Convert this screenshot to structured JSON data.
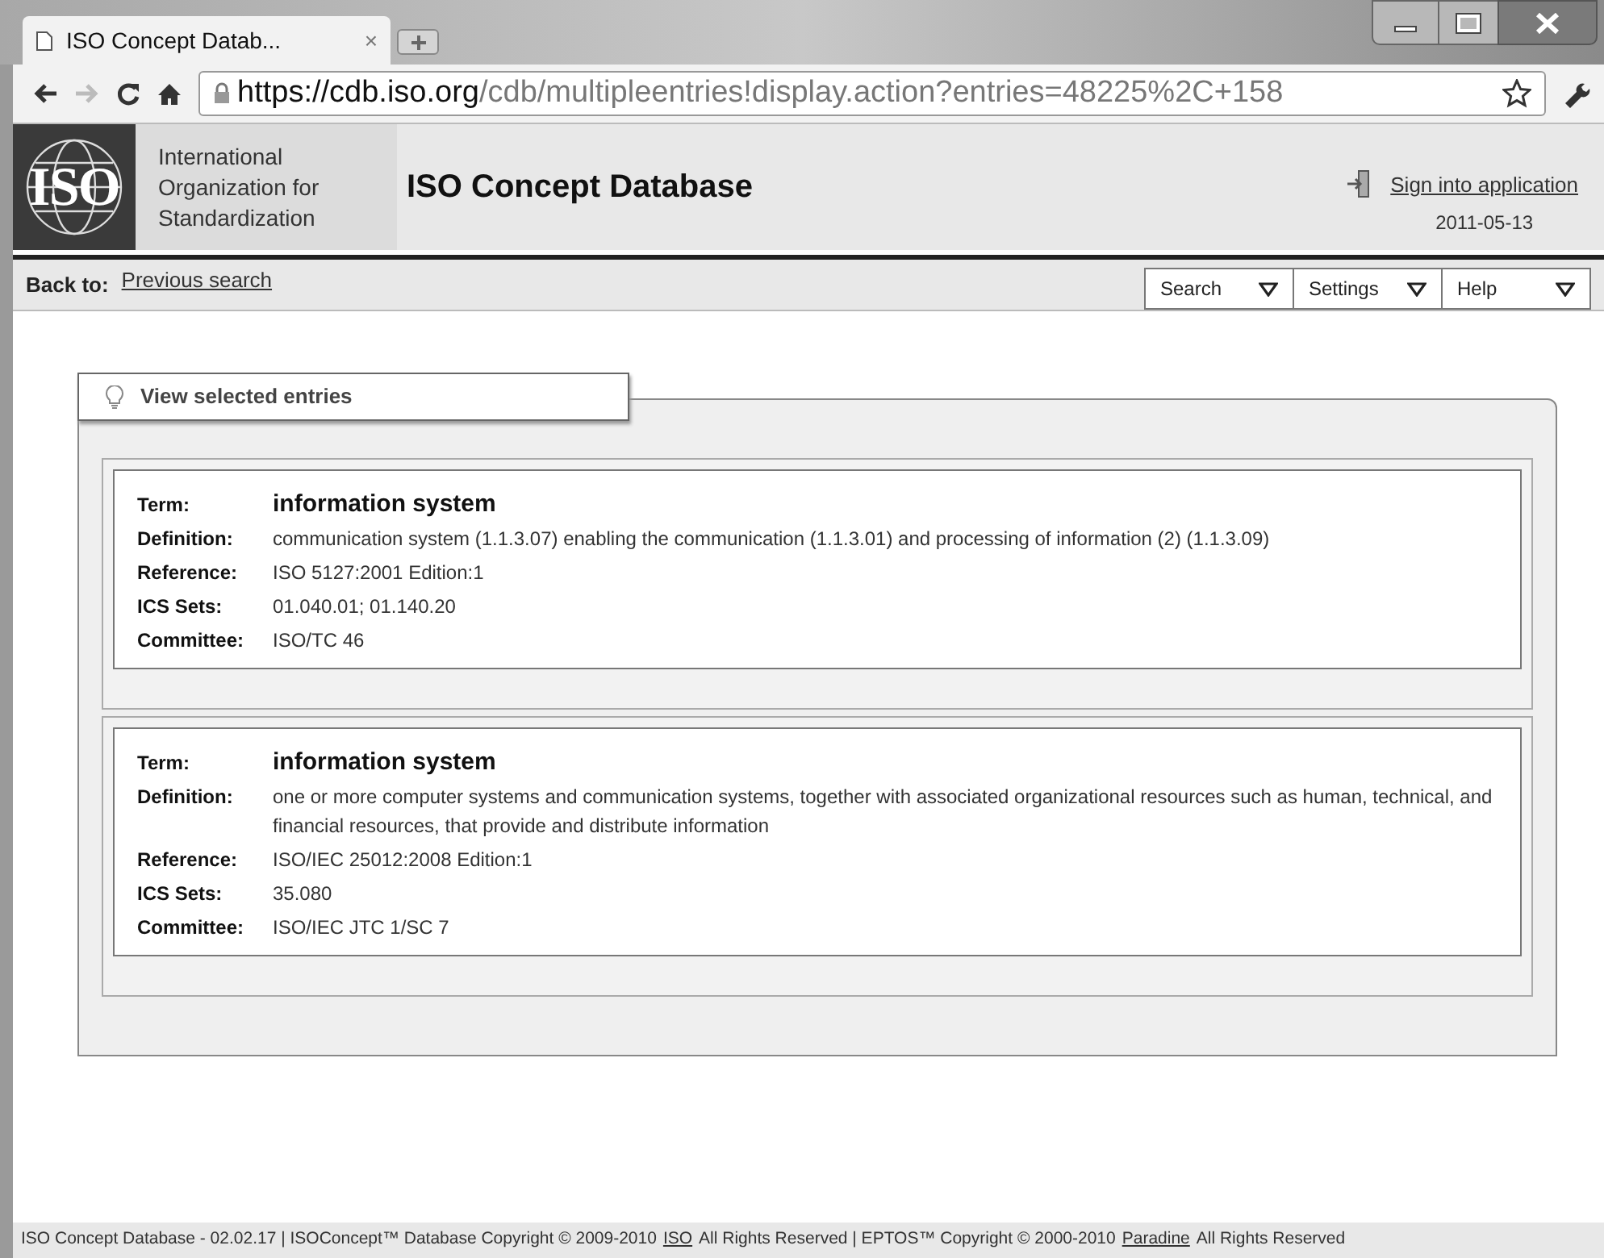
{
  "browser": {
    "tab_title": "ISO Concept Datab...",
    "tab_close": "×",
    "url_host": "https://cdb.iso.org",
    "url_path": "/cdb/multipleentries!display.action?entries=48225%2C+158"
  },
  "header": {
    "logo": "ISO",
    "org_lines": [
      "International",
      "Organization for",
      "Standardization"
    ],
    "title": "ISO Concept Database",
    "sign_in": "Sign into application",
    "date": "2011-05-13"
  },
  "nav": {
    "back_label": "Back to:",
    "back_link": "Previous search",
    "menus": [
      "Search",
      "Settings",
      "Help"
    ]
  },
  "panel": {
    "title": "View selected entries"
  },
  "entries": [
    {
      "fields": [
        {
          "kind": "term",
          "label": "Term:",
          "value": "information system"
        },
        {
          "kind": "text",
          "label": "Definition:",
          "value": "communication system (1.1.3.07) enabling the communication (1.1.3.01) and processing of information (2) (1.1.3.09)"
        },
        {
          "kind": "text",
          "label": "Reference:",
          "value": "ISO 5127:2001 Edition:1"
        },
        {
          "kind": "text",
          "label": "ICS Sets:",
          "value": "01.040.01; 01.140.20"
        },
        {
          "kind": "text",
          "label": "Committee:",
          "value": "ISO/TC 46"
        }
      ]
    },
    {
      "fields": [
        {
          "kind": "term",
          "label": "Term:",
          "value": "information system"
        },
        {
          "kind": "text",
          "label": "Definition:",
          "value": "one or more computer systems and communication systems, together with associated organizational resources such as human, technical, and financial resources, that provide and distribute information"
        },
        {
          "kind": "text",
          "label": "Reference:",
          "value": "ISO/IEC 25012:2008 Edition:1"
        },
        {
          "kind": "text",
          "label": "ICS Sets:",
          "value": "35.080"
        },
        {
          "kind": "text",
          "label": "Committee:",
          "value": "ISO/IEC JTC 1/SC 7"
        }
      ]
    }
  ],
  "footer": [
    {
      "kind": "text",
      "text": "ISO Concept Database - 02.02.17 | ISOConcept™ Database Copyright © 2009-2010"
    },
    {
      "kind": "link",
      "text": "ISO"
    },
    {
      "kind": "text",
      "text": "All Rights Reserved | EPTOS™ Copyright © 2000-2010"
    },
    {
      "kind": "link",
      "text": "Paradine"
    },
    {
      "kind": "text",
      "text": "All Rights Reserved"
    }
  ]
}
